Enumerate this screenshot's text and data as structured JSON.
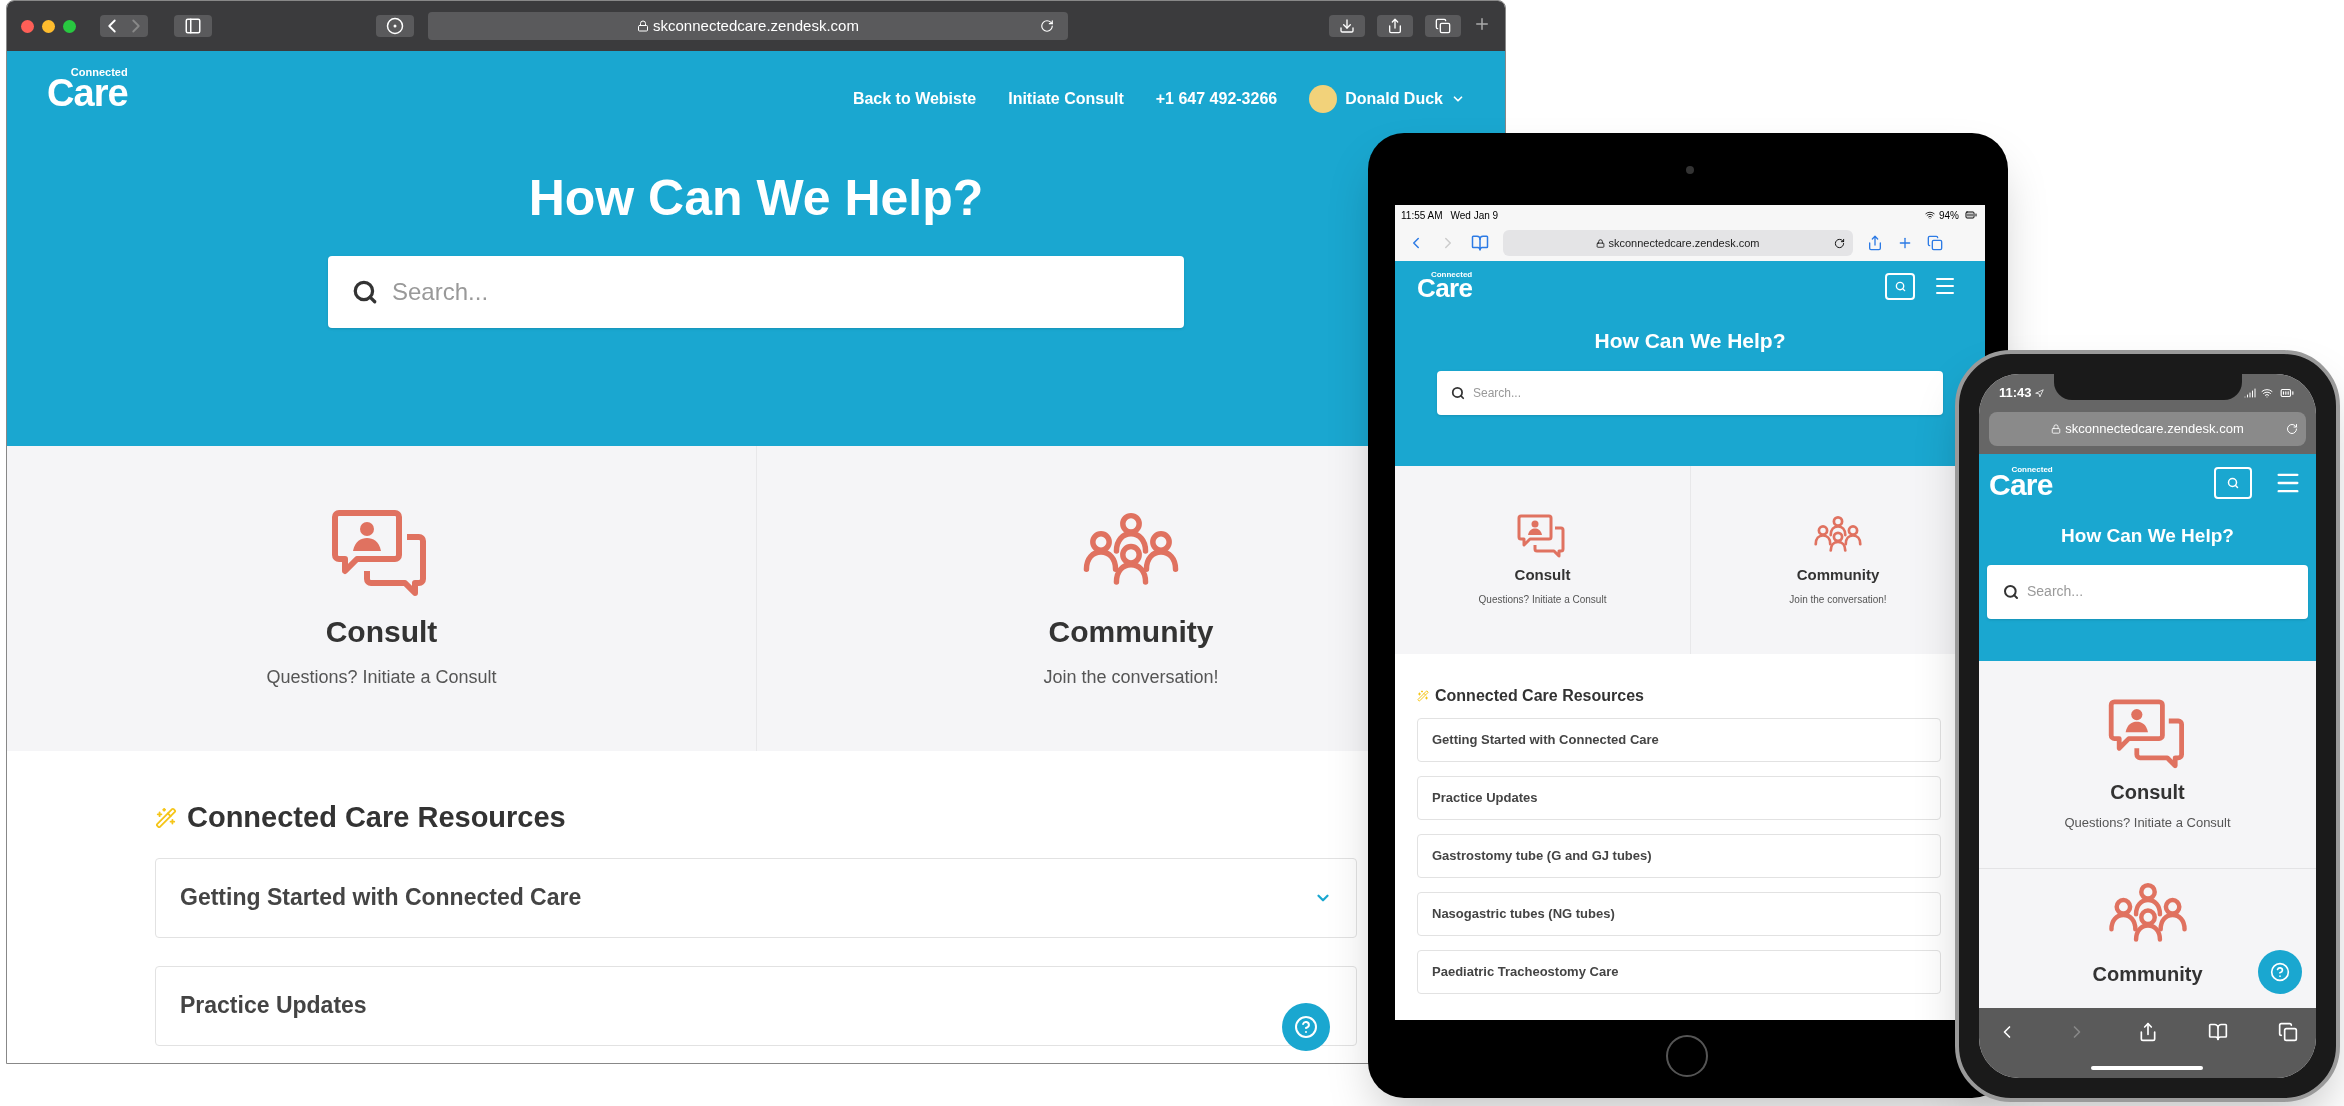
{
  "desktop": {
    "url": "skconnectedcare.zendesk.com",
    "logo": {
      "tagline": "Connected",
      "name": "Care"
    },
    "nav_links": [
      "Back to Webiste",
      "Initiate Consult",
      "+1 647 492-3266"
    ],
    "user": "Donald Duck",
    "hero_title": "How Can We Help?",
    "search": {
      "placeholder": "Search..."
    },
    "cards": [
      {
        "kind": "consult",
        "title": "Consult",
        "subtitle": "Questions? Initiate a Consult"
      },
      {
        "kind": "community",
        "title": "Community",
        "subtitle": "Join the conversation!"
      }
    ],
    "resources": {
      "title": "Connected Care Resources",
      "items": [
        "Getting Started with Connected Care",
        "Practice Updates"
      ]
    }
  },
  "tablet": {
    "status_bar": {
      "time": "11:55 AM",
      "date": "Wed Jan 9",
      "battery": "94%"
    },
    "url": "skconnectedcare.zendesk.com",
    "logo": {
      "tagline": "Connected",
      "name": "Care"
    },
    "hero_title": "How Can We Help?",
    "search": {
      "placeholder": "Search..."
    },
    "cards": [
      {
        "kind": "consult",
        "title": "Consult",
        "subtitle": "Questions? Initiate a Consult"
      },
      {
        "kind": "community",
        "title": "Community",
        "subtitle": "Join the conversation!"
      }
    ],
    "resources": {
      "title": "Connected Care Resources",
      "items": [
        "Getting Started with Connected Care",
        "Practice Updates",
        "Gastrostomy tube (G and GJ tubes)",
        "Nasogastric tubes (NG tubes)",
        "Paediatric Tracheostomy Care"
      ]
    }
  },
  "phone": {
    "status_bar": {
      "time": "11:43"
    },
    "url": "skconnectedcare.zendesk.com",
    "logo": {
      "tagline": "Connected",
      "name": "Care"
    },
    "hero_title": "How Can We Help?",
    "search": {
      "placeholder": "Search..."
    },
    "cards": [
      {
        "kind": "consult",
        "title": "Consult",
        "subtitle": "Questions? Initiate a Consult"
      },
      {
        "kind": "community",
        "title": "Community"
      }
    ]
  }
}
